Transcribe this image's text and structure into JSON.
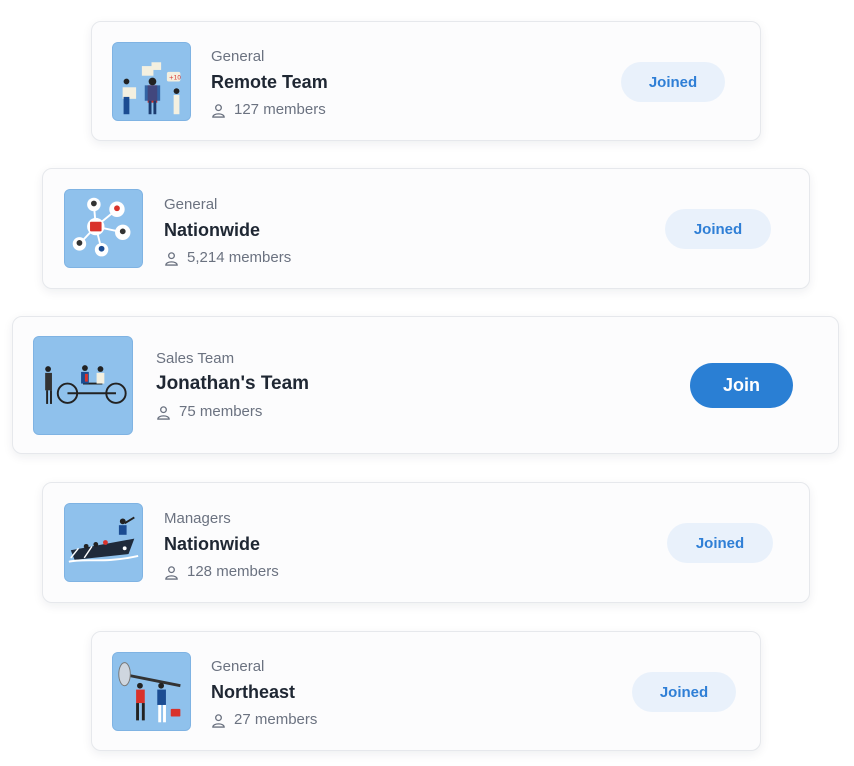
{
  "groups": [
    {
      "category": "General",
      "name": "Remote Team",
      "members_count": "127",
      "members_suffix": "members",
      "action": "Joined",
      "thumb_icon": "remote-team-illustration"
    },
    {
      "category": "General",
      "name": "Nationwide",
      "members_count": "5,214",
      "members_suffix": "members",
      "action": "Joined",
      "thumb_icon": "network-people-illustration"
    },
    {
      "category": "Sales Team",
      "name": "Jonathan's Team",
      "members_count": "75",
      "members_suffix": "members",
      "action": "Join",
      "thumb_icon": "tandem-bicycle-illustration"
    },
    {
      "category": "Managers",
      "name": "Nationwide",
      "members_count": "128",
      "members_suffix": "members",
      "action": "Joined",
      "thumb_icon": "boat-rowing-illustration"
    },
    {
      "category": "General",
      "name": "Northeast",
      "members_count": "27",
      "members_suffix": "members",
      "action": "Joined",
      "thumb_icon": "weightlifting-illustration"
    }
  ],
  "colors": {
    "accent": "#2a7fd4",
    "joined_bg": "#e9f1fb",
    "thumb_bg": "#8fc1ec"
  }
}
